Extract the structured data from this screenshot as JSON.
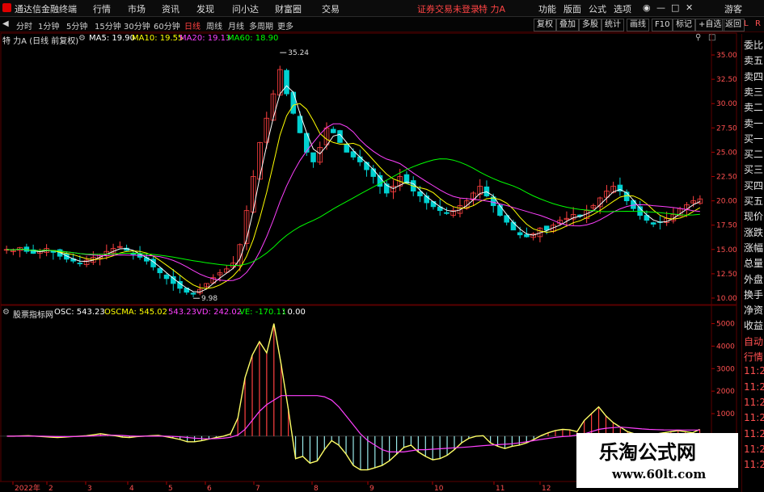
{
  "menubar": {
    "app_title": "通达信金融终端",
    "items": [
      "行情",
      "市场",
      "资讯",
      "发现",
      "问小达",
      "财富圈",
      "交易"
    ],
    "status_text": "证券交易未登录",
    "stock_name": "特 力A",
    "right_items": [
      "功能",
      "版面",
      "公式",
      "选项"
    ],
    "user": "游客"
  },
  "period_tabs": [
    "分时",
    "1分钟",
    "5分钟",
    "15分钟",
    "30分钟",
    "60分钟",
    "日线",
    "周线",
    "月线",
    "多周期",
    "更多"
  ],
  "active_tab": "日线",
  "right_buttons": [
    "复权",
    "叠加",
    "多股",
    "统计",
    "画线",
    "F10",
    "标记",
    "+自选",
    "返回"
  ],
  "chart_header": {
    "title": "特 力A (日线 前复权)",
    "ma5": "MA5: 19.90",
    "ma10": "MA10: 19.55",
    "ma20": "MA20: 19.13",
    "ma60": "MA60: 18.90",
    "colors": {
      "ma5": "#ffffff",
      "ma10": "#ffff00",
      "ma20": "#ff40ff",
      "ma60": "#00ff00"
    }
  },
  "indicator_header": {
    "name": "股票指标网",
    "osc": "OSC: 543.23",
    "oscma": "OSCMA: 545.02",
    "val3": "543.23",
    "vd": "VD: 242.02",
    "ve": "VE: -170.11",
    "zero": ": 0.00"
  },
  "sidebar": {
    "top_marks": [
      "L",
      "R"
    ],
    "items": [
      "委比",
      "卖五",
      "卖四",
      "卖三",
      "卖二",
      "卖一",
      "买一",
      "买二",
      "买三",
      "买四",
      "买五",
      "现价",
      "涨跌",
      "涨幅",
      "总量",
      "外盘",
      "换手",
      "净资",
      "收益",
      "自动",
      "行情",
      "11:2",
      "11:2",
      "11:2",
      "11:2",
      "11:2",
      "11:2",
      "11:2"
    ]
  },
  "chart_data": [
    {
      "type": "candlestick",
      "title": "特 力A (日线 前复权)",
      "ylim": [
        9.5,
        36
      ],
      "y_ticks": [
        "35.00",
        "32.50",
        "30.00",
        "27.50",
        "25.00",
        "22.50",
        "20.00",
        "17.50",
        "15.00",
        "12.50",
        "10.00"
      ],
      "annotations": [
        {
          "label": "35.24",
          "kind": "high"
        },
        {
          "label": "9.98",
          "kind": "low"
        }
      ],
      "series": [
        {
          "name": "MA5",
          "color": "#ffffff"
        },
        {
          "name": "MA10",
          "color": "#ffff00"
        },
        {
          "name": "MA20",
          "color": "#ff40ff"
        },
        {
          "name": "MA60",
          "color": "#00ff00"
        }
      ],
      "close_path": [
        15.0,
        14.9,
        15.2,
        14.8,
        14.6,
        14.9,
        15.1,
        14.7,
        14.3,
        14.0,
        13.8,
        13.6,
        13.9,
        14.2,
        14.5,
        14.8,
        15.1,
        15.3,
        14.9,
        14.5,
        14.2,
        13.8,
        13.2,
        12.6,
        12.0,
        11.5,
        11.0,
        10.6,
        10.4,
        10.9,
        11.5,
        12.1,
        12.6,
        13.0,
        13.6,
        15.5,
        19.0,
        22.5,
        26.0,
        28.5,
        31.0,
        33.5,
        31.0,
        29.0,
        27.0,
        25.0,
        24.0,
        25.5,
        27.5,
        27.0,
        26.0,
        25.0,
        24.5,
        24.0,
        23.2,
        22.5,
        21.5,
        20.8,
        21.5,
        22.5,
        21.8,
        21.0,
        20.5,
        19.8,
        19.4,
        19.0,
        18.7,
        19.0,
        19.5,
        20.0,
        20.8,
        21.5,
        20.5,
        19.5,
        18.5,
        17.8,
        17.0,
        16.5,
        16.3,
        16.6,
        17.2,
        17.0,
        17.5,
        18.0,
        18.2,
        18.6,
        18.4,
        19.0,
        19.5,
        20.3,
        21.0,
        21.5,
        21.0,
        20.0,
        19.2,
        18.5,
        18.0,
        17.6,
        17.8,
        18.2,
        18.6,
        19.2,
        19.6,
        20.0,
        20.2
      ]
    },
    {
      "type": "bar",
      "title": "股票指标网",
      "ylim": [
        -1800,
        5200
      ],
      "y_ticks": [
        "5000",
        "4000",
        "3000",
        "2000",
        "1000"
      ],
      "osc_path": [
        0,
        0,
        10,
        20,
        0,
        -20,
        -40,
        -60,
        -40,
        -20,
        0,
        20,
        60,
        110,
        60,
        20,
        -40,
        -60,
        -20,
        0,
        20,
        30,
        -20,
        -80,
        -150,
        -250,
        -250,
        -200,
        -130,
        -60,
        0,
        100,
        800,
        2600,
        3600,
        4200,
        3700,
        5000,
        3200,
        1200,
        -1000,
        -900,
        -1200,
        -1100,
        -600,
        -200,
        -400,
        -800,
        -1300,
        -1500,
        -1500,
        -1400,
        -1300,
        -1100,
        -800,
        -500,
        -400,
        -700,
        -900,
        -1050,
        -1000,
        -850,
        -600,
        -300,
        -100,
        0,
        20,
        -300,
        -450,
        -550,
        -450,
        -400,
        -300,
        -150,
        20,
        150,
        250,
        300,
        280,
        200,
        700,
        1000,
        1300,
        900,
        600,
        400,
        200,
        100,
        80,
        60,
        100,
        150,
        200,
        250,
        200,
        150,
        300
      ],
      "oscma_path": [
        0,
        0,
        0,
        0,
        0,
        0,
        -10,
        -20,
        -20,
        -20,
        -10,
        0,
        10,
        30,
        40,
        40,
        30,
        10,
        0,
        0,
        0,
        0,
        0,
        -10,
        -30,
        -60,
        -90,
        -110,
        -120,
        -110,
        -90,
        -50,
        50,
        300,
        700,
        1100,
        1400,
        1600,
        1800,
        1800,
        1800,
        1800,
        1800,
        1800,
        1750,
        1600,
        1300,
        900,
        500,
        100,
        -200,
        -400,
        -600,
        -700,
        -700,
        -700,
        -650,
        -600,
        -600,
        -580,
        -560,
        -540,
        -520,
        -500,
        -480,
        -450,
        -420,
        -400,
        -380,
        -360,
        -340,
        -300,
        -250,
        -200,
        -150,
        -100,
        -50,
        -20,
        0,
        50,
        100,
        200,
        300,
        350,
        380,
        400,
        380,
        350,
        320,
        300,
        290,
        280,
        275,
        275,
        270,
        270,
        270
      ],
      "osc_line_color": "#ffff66",
      "oscma_line_color": "#ff40ff"
    }
  ],
  "x_axis_labels": [
    "2022年",
    "2",
    "3",
    "4",
    "5",
    "6",
    "7",
    "8",
    "9",
    "10",
    "11",
    "12"
  ],
  "watermark": {
    "title": "乐淘公式网",
    "url": "www.60lt.com"
  }
}
